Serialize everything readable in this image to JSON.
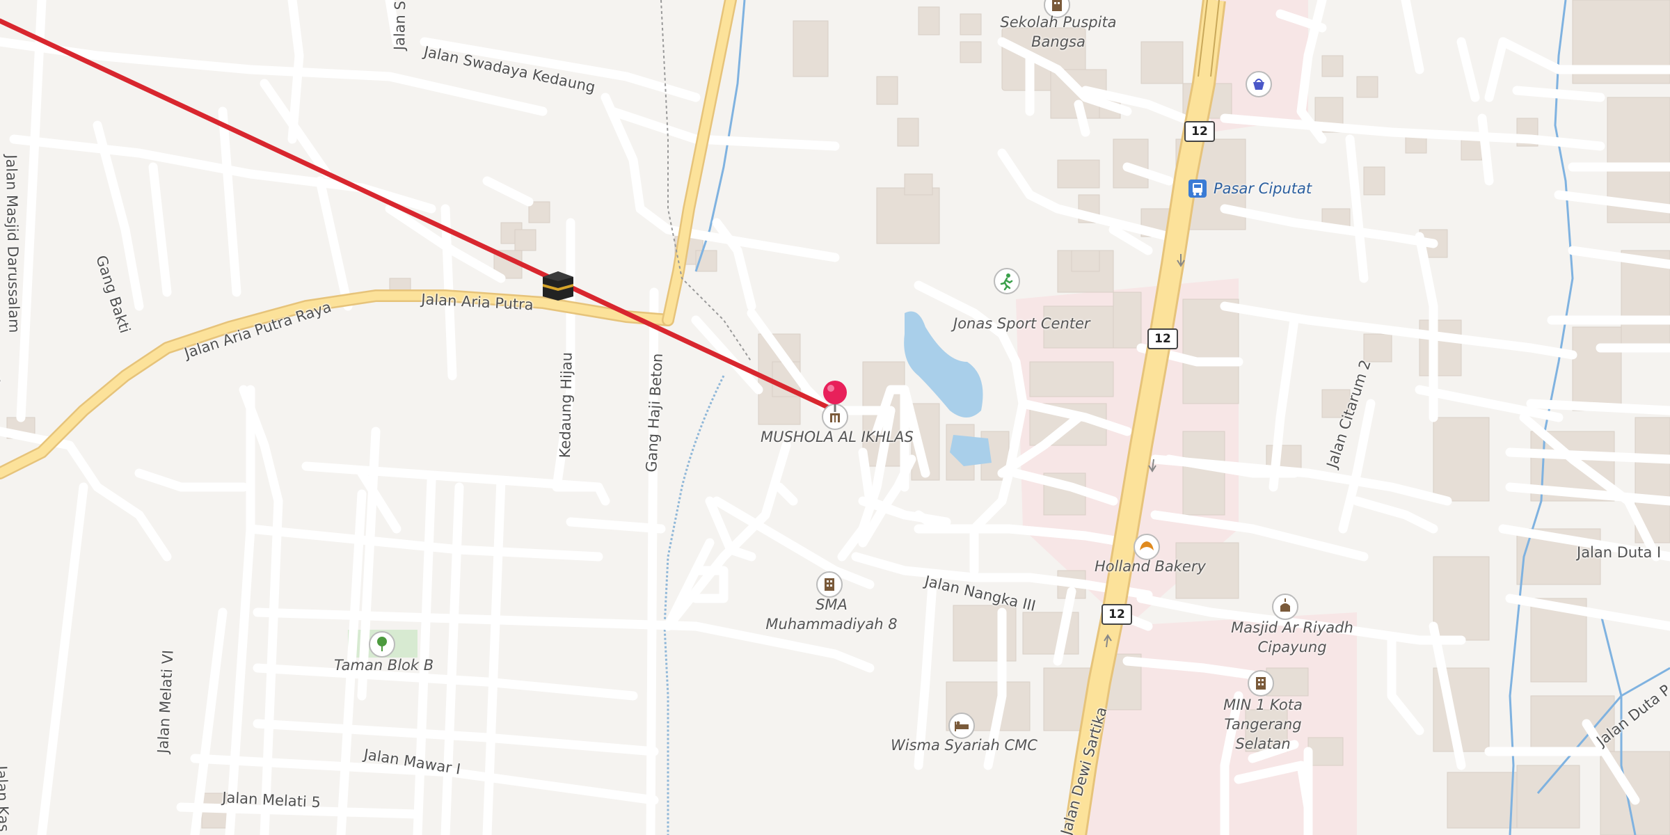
{
  "map": {
    "roads": {
      "aria_putra_raya": "Jalan Aria Putra Raya",
      "aria_putra": "Jalan Aria Putra",
      "swadaya_kedaung": "Jalan Swadaya Kedaung",
      "masjid_darussalam": "Jalan Masjid Darussalam",
      "gang_bakti": "Gang Bakti",
      "kedaung_hijau": "Kedaung Hijau",
      "gang_haji_beton": "Gang Haji Beton",
      "nangka_iii": "Jalan Nangka III",
      "dewi_sartika": "Jalan Dewi Sartika",
      "citarum_2": "Jalan Citarum 2",
      "duta_1": "Jalan Duta I",
      "duta_2": "Jalan Duta P",
      "melati_vi": "Jalan Melati VI",
      "mawar_i": "Jalan Mawar I",
      "melati_5": "Jalan Melati 5",
      "kas": "Jalan Kas",
      "top_partial": "Jalan S",
      "left_partial": "an"
    },
    "route_shield": "12",
    "pois": {
      "sekolah": "Sekolah Puspita Bangsa",
      "pasar": "Pasar Ciputat",
      "jonas": "Jonas Sport Center",
      "mushola": "MUSHOLA AL IKHLAS",
      "holland": "Holland Bakery",
      "sma": "SMA Muhammadiyah 8",
      "masjid_riyadh": "Masjid Ar Riyadh Cipayung",
      "min1": "MIN 1 Kota Tangerang Selatan",
      "taman": "Taman Blok B",
      "wisma": "Wisma Syariah CMC"
    },
    "colors": {
      "background": "#f5f3f0",
      "minor_road": "#ffffff",
      "main_road_fill": "#fce29a",
      "main_road_casing": "#e6c37a",
      "qibla_line": "#d8262e",
      "water": "#a9cfea",
      "building": "#e6ded6",
      "pin": "#e8205a"
    },
    "icons": {
      "kaaba": "kaaba-icon",
      "pin": "location-pin-icon",
      "school": "school-icon",
      "bus": "bus-stop-icon",
      "shop": "shopping-basket-icon",
      "sport": "running-icon",
      "bakery": "croissant-icon",
      "mosque": "mosque-icon",
      "park": "tree-icon",
      "hotel": "bed-icon"
    }
  }
}
